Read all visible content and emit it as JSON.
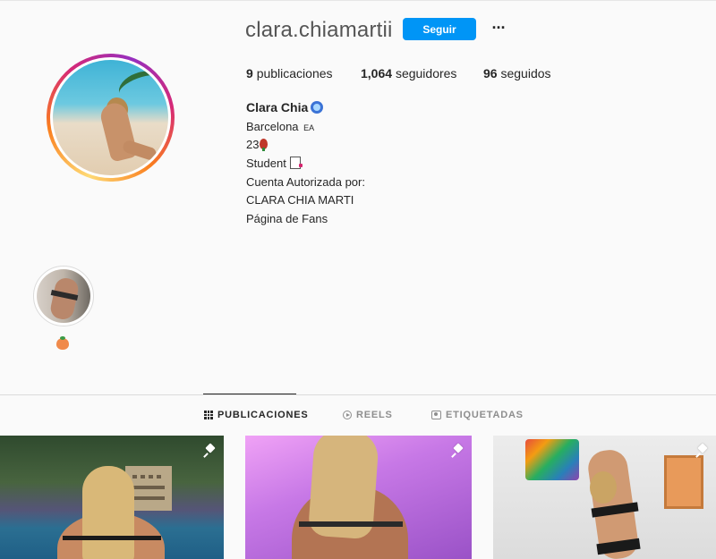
{
  "profile": {
    "username": "clara.chiamartii",
    "follow_label": "Seguir",
    "more_label": "···",
    "stats": {
      "posts_count": "9",
      "posts_label": "publicaciones",
      "followers_count": "1,064",
      "followers_label": "seguidores",
      "following_count": "96",
      "following_label": "seguidos"
    },
    "bio": {
      "name": "Clara Chia",
      "city": "Barcelona",
      "city_suffix": "EA",
      "age": "23",
      "occupation": "Student",
      "authorized_line": "Cuenta Autorizada por:",
      "owner": "CLARA CHIA MARTI",
      "fans": "Página de Fans"
    },
    "icons": {
      "verified": "verified-badge-icon",
      "rose": "rose-icon",
      "memo": "memo-icon"
    }
  },
  "highlights": [
    {
      "icon": "peach-icon"
    }
  ],
  "tabs": [
    {
      "label": "PUBLICACIONES",
      "icon": "grid-icon",
      "active": true
    },
    {
      "label": "REELS",
      "icon": "reels-icon",
      "active": false
    },
    {
      "label": "ETIQUETADAS",
      "icon": "tag-icon",
      "active": false
    }
  ],
  "posts": [
    {
      "pinned": true,
      "icon": "pin-icon"
    },
    {
      "pinned": true,
      "icon": "pin-icon"
    },
    {
      "pinned": true,
      "icon": "pin-icon"
    }
  ],
  "colors": {
    "accent": "#0095f6",
    "background": "#fafafa",
    "text": "#262626",
    "muted": "#8e8e8e"
  }
}
